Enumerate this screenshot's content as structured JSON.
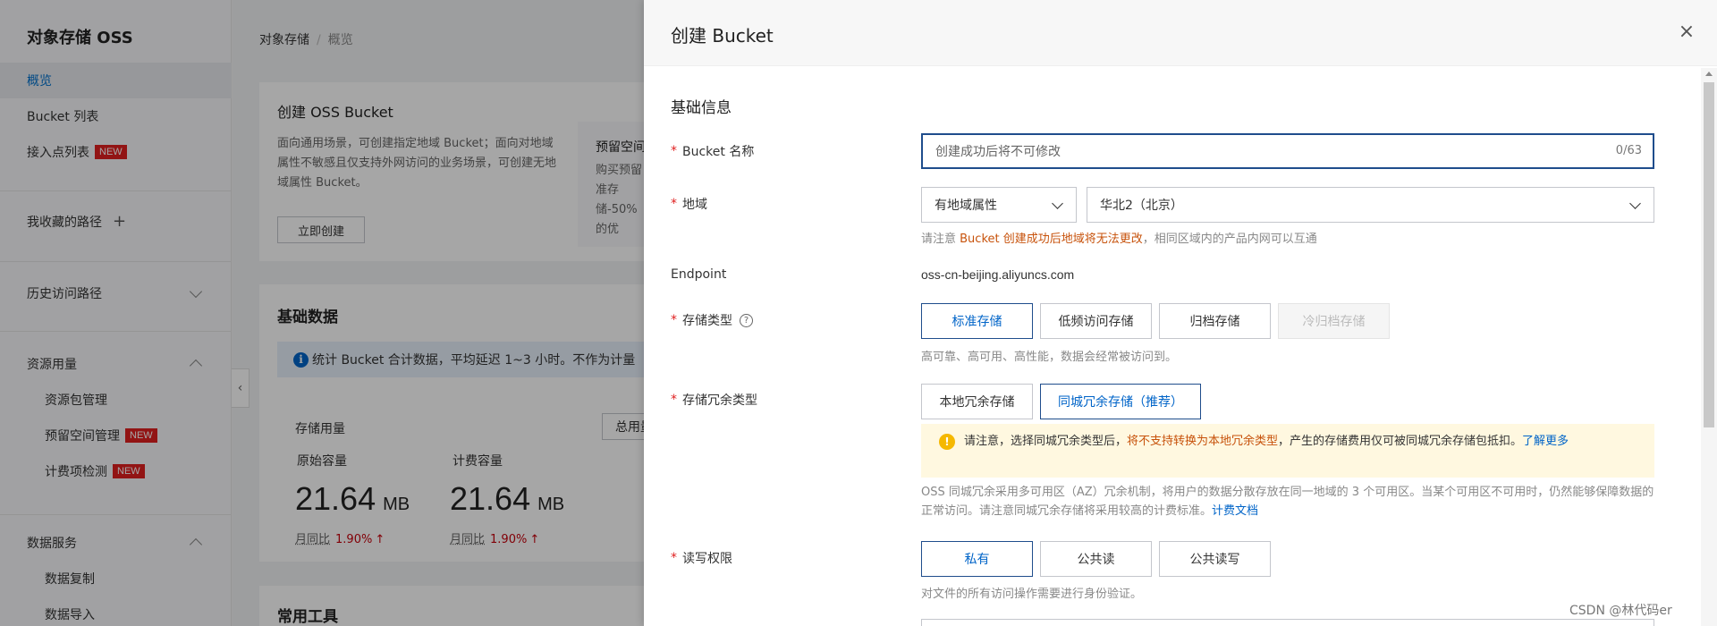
{
  "sidebar": {
    "title": "对象存储 OSS",
    "items": [
      {
        "label": "概览"
      },
      {
        "label": "Bucket 列表"
      },
      {
        "label": "接入点列表",
        "badge": "NEW"
      },
      {
        "label": "我收藏的路径",
        "plus": "+"
      },
      {
        "label": "历史访问路径"
      },
      {
        "label": "资源用量"
      },
      {
        "label": "资源包管理"
      },
      {
        "label": "预留空间管理",
        "badge": "NEW"
      },
      {
        "label": "计费项检测",
        "badge": "NEW"
      },
      {
        "label": "数据服务"
      },
      {
        "label": "数据复制"
      },
      {
        "label": "数据导入"
      }
    ]
  },
  "main": {
    "breadcrumb": {
      "root": "对象存储",
      "sep": "/",
      "current": "概览"
    },
    "create_card": {
      "title": "创建 OSS Bucket",
      "desc": "面向通用场景，可创建指定地域 Bucket；面向对地域属性不敏感且仅支持外网访问的业务场景，可创建无地域属性 Bucket。",
      "button": "立即创建"
    },
    "reserve_card": {
      "title": "预留空间",
      "desc": "购买预留准存储-50% 的优"
    },
    "basic_data": {
      "title": "基础数据",
      "notice": "统计 Bucket 合计数据，平均延迟 1~3 小时。不作为计量",
      "storage_label": "存储用量",
      "storage_select": "总用量（不含 ECS 快照）",
      "raw_label": "原始容量",
      "billed_label": "计费容量",
      "raw_value": "21.64",
      "raw_unit": "MB",
      "billed_value": "21.64",
      "billed_unit": "MB",
      "yoy_label": "月同比",
      "raw_yoy": "1.90%",
      "billed_yoy": "1.90%",
      "trend_arrow": "↑"
    },
    "tools_title": "常用工具"
  },
  "drawer": {
    "title": "创建 Bucket",
    "close": "×",
    "section": "基础信息",
    "required_mark": "*",
    "bucket_name": {
      "label": "Bucket 名称",
      "placeholder": "创建成功后将不可修改",
      "counter": "0/63"
    },
    "region": {
      "label": "地域",
      "attr_select": "有地域属性",
      "region_select": "华北2（北京）",
      "hint_pre": "请注意 ",
      "hint_warn": "Bucket 创建成功后地域将无法更改",
      "hint_post": "，相同区域内的产品内网可以互通"
    },
    "endpoint": {
      "label": "Endpoint",
      "value": "oss-cn-beijing.aliyuncs.com"
    },
    "storage_class": {
      "label": "存储类型",
      "help": "?",
      "options": [
        "标准存储",
        "低频访问存储",
        "归档存储",
        "冷归档存储"
      ],
      "hint": "高可靠、高可用、高性能，数据会经常被访问到。"
    },
    "redundancy": {
      "label": "存储冗余类型",
      "options": [
        "本地冗余存储",
        "同城冗余存储（推荐）"
      ],
      "warn_icon": "!",
      "warn_pre": "请注意，选择同城冗余类型后，",
      "warn_hl": "将不支持转换为本地冗余类型",
      "warn_post": "，产生的存储费用仅可被同城冗余存储包抵扣。",
      "warn_link": "了解更多",
      "info": "OSS 同城冗余采用多可用区（AZ）冗余机制，将用户的数据分散存放在同一地域的 3 个可用区。当某个可用区不可用时，仍然能够保障数据的正常访问。请注意同城冗余存储将采用较高的计费标准。",
      "info_link": "计费文档"
    },
    "acl": {
      "label": "读写权限",
      "options": [
        "私有",
        "公共读",
        "公共读写"
      ],
      "hint": "对文件的所有访问操作需要进行身份验证。"
    }
  },
  "watermark": "CSDN @林代码er",
  "colors": {
    "brand": "#0064c8",
    "selected_border": "#1f4d8c",
    "warn": "#c7520b",
    "badge": "#e02020"
  }
}
